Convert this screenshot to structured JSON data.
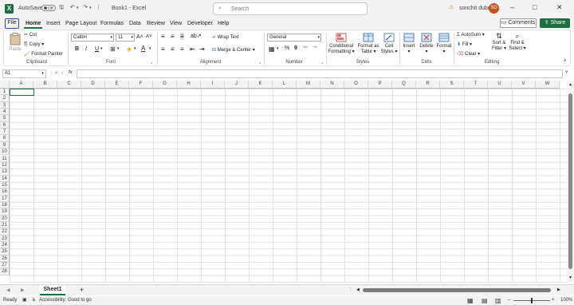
{
  "titlebar": {
    "autosave_label": "AutoSave",
    "autosave_state": "Off",
    "doc_title": "Book1 - Excel",
    "search_placeholder": "Search",
    "user_name": "sonchit dubey",
    "user_initials": "SD"
  },
  "tabs": [
    "File",
    "Home",
    "Insert",
    "Page Layout",
    "Formulas",
    "Data",
    "Review",
    "View",
    "Developer",
    "Help"
  ],
  "active_tab": "Home",
  "buttons": {
    "comments": "Comments",
    "share": "Share"
  },
  "ribbon": {
    "clipboard": {
      "label": "Clipboard",
      "paste": "Paste",
      "cut": "Cut",
      "copy": "Copy",
      "format_painter": "Format Painter"
    },
    "font": {
      "label": "Font",
      "name": "Calibri",
      "size": "11",
      "bold": "B",
      "italic": "I",
      "underline": "U"
    },
    "alignment": {
      "label": "Alignment",
      "wrap_text": "Wrap Text",
      "merge_center": "Merge & Center"
    },
    "number": {
      "label": "Number",
      "format": "General",
      "percent": "%",
      "comma": "9"
    },
    "styles": {
      "label": "Styles",
      "conditional_1": "Conditional",
      "conditional_2": "Formatting",
      "format_table_1": "Format as",
      "format_table_2": "Table",
      "cell_styles_1": "Cell",
      "cell_styles_2": "Styles"
    },
    "cells": {
      "label": "Cells",
      "insert": "Insert",
      "delete": "Delete",
      "format": "Format"
    },
    "editing": {
      "label": "Editing",
      "autosum": "AutoSum",
      "fill": "Fill",
      "clear": "Clear",
      "sort_1": "Sort &",
      "sort_2": "Filter",
      "find_1": "Find &",
      "find_2": "Select"
    }
  },
  "formula_bar": {
    "name_box": "A1",
    "fx": "fx",
    "value": ""
  },
  "columns": [
    "A",
    "B",
    "C",
    "D",
    "E",
    "F",
    "G",
    "H",
    "I",
    "J",
    "K",
    "L",
    "M",
    "N",
    "O",
    "P",
    "Q",
    "R",
    "S",
    "T",
    "U",
    "V",
    "W"
  ],
  "rows": [
    "1",
    "2",
    "3",
    "4",
    "5",
    "6",
    "7",
    "8",
    "9",
    "10",
    "11",
    "12",
    "13",
    "14",
    "15",
    "16",
    "17",
    "18",
    "19",
    "20",
    "21",
    "22",
    "23",
    "24",
    "25",
    "26",
    "27",
    "28"
  ],
  "sheet_tabs": [
    "Sheet1"
  ],
  "status": {
    "ready": "Ready",
    "accessibility": "Accessibility: Good to go",
    "zoom": "100%"
  },
  "colors": {
    "accent": "#1d6f42",
    "file_border": "#2e46c2",
    "avatar": "#c8501f"
  }
}
